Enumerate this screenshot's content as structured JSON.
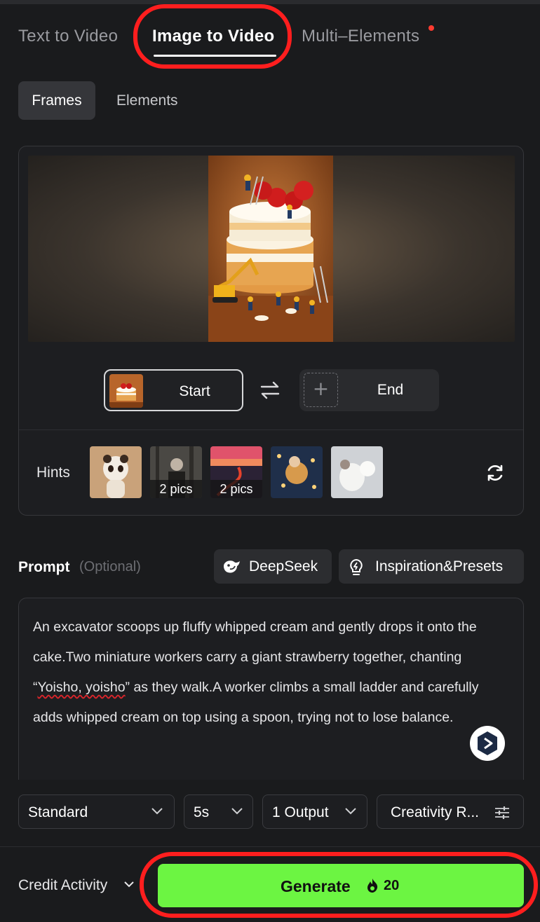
{
  "tabs": [
    {
      "label": "Text to Video"
    },
    {
      "label": "Image to Video",
      "active": true
    },
    {
      "label": "Multi–Elements",
      "has_dot": true
    }
  ],
  "subtabs": [
    {
      "label": "Frames",
      "active": true
    },
    {
      "label": "Elements"
    }
  ],
  "frames": {
    "start_label": "Start",
    "end_label": "End"
  },
  "hints": {
    "label": "Hints",
    "items": [
      {
        "name": "panda",
        "badge": ""
      },
      {
        "name": "forest",
        "badge": "2 pics"
      },
      {
        "name": "sunset-road",
        "badge": "2 pics"
      },
      {
        "name": "lights",
        "badge": ""
      },
      {
        "name": "white-cat",
        "badge": ""
      }
    ]
  },
  "prompt": {
    "label": "Prompt",
    "optional": "(Optional)",
    "deepseek_label": "DeepSeek",
    "presets_label": "Inspiration&Presets",
    "text_before": "An excavator scoops up fluffy whipped cream and gently drops it onto the cake.Two miniature workers carry a giant strawberry together, chanting “",
    "text_underlined": "Yoisho, yoisho",
    "text_after": "” as they walk.A worker climbs a small ladder and carefully adds whipped cream on top using a spoon, trying not to lose balance."
  },
  "settings": {
    "mode": "Standard",
    "duration": "5s",
    "outputs": "1 Output",
    "creativity": "Creativity R..."
  },
  "bottom": {
    "credit_label": "Credit Activity",
    "generate_label": "Generate",
    "generate_cost": "20"
  },
  "colors": {
    "background": "#1a1b1d",
    "accent_green": "#6cf542",
    "annotation_red": "#ff1e1e",
    "notification_dot": "#ff3b30"
  }
}
